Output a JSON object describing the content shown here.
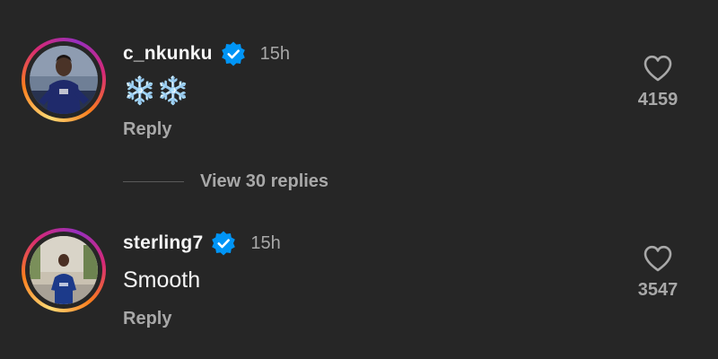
{
  "comments": [
    {
      "username": "c_nkunku",
      "verified": true,
      "time": "15h",
      "text": "❄️❄️",
      "reply_label": "Reply",
      "likes": "4159",
      "avatar": "player-in-blue-kit"
    },
    {
      "username": "sterling7",
      "verified": true,
      "time": "15h",
      "text": "Smooth",
      "reply_label": "Reply",
      "likes": "3547",
      "avatar": "player-standing-outdoors"
    }
  ],
  "view_replies": {
    "label": "View 30 replies"
  },
  "icons": {
    "verified": "verified-badge-icon",
    "like": "heart-icon"
  },
  "colors": {
    "background": "#262626",
    "primary_text": "#f5f5f5",
    "secondary_text": "#a8a8a8",
    "verified_blue": "#0095f6"
  }
}
